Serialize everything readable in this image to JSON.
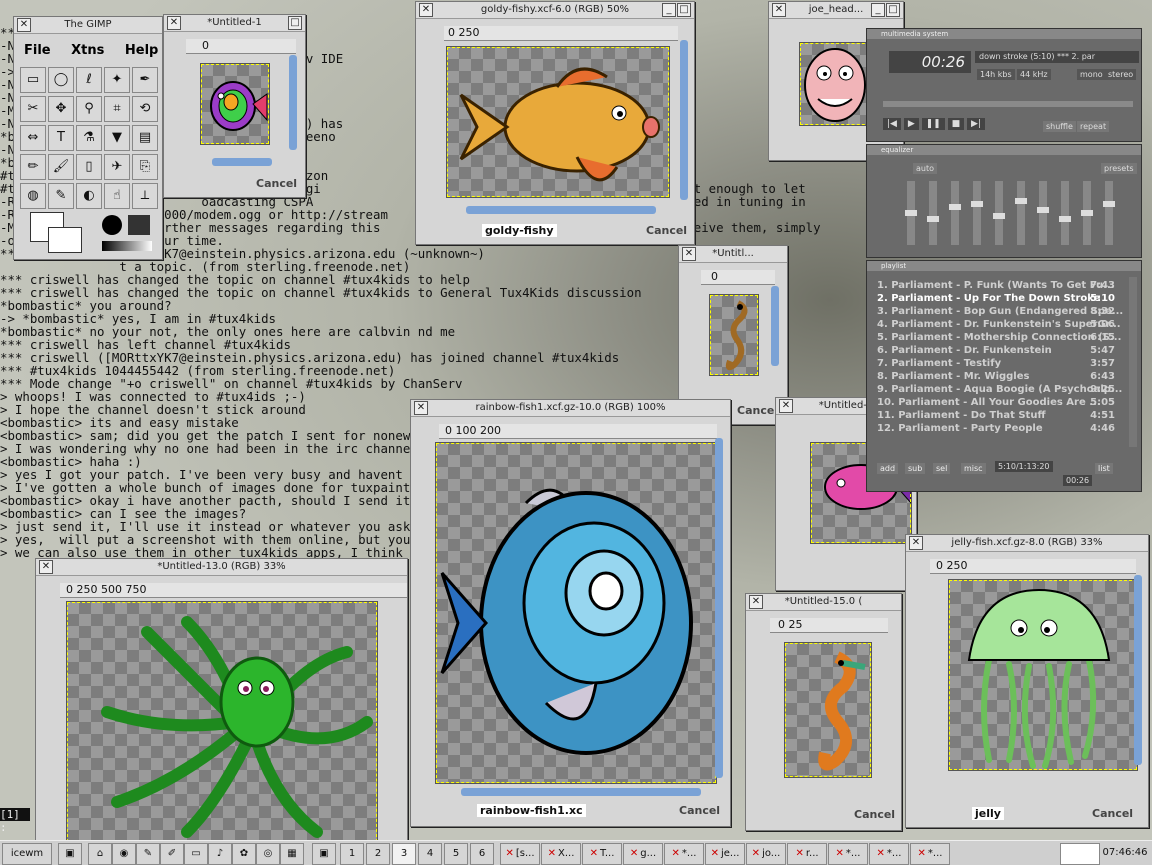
{
  "terminal": {
    "lines": [
      "*** - the network!",
      "-N                            e else",
      "-N                            msg NickServ IDE",
      "->",
      "-N                            recognized",
      "-N                            ervices.",
      "-M",
      "-N                            arizona.edu) has",
      "*b                            sterling.freeno",
      "-N                            node.net)",
      "*b                            criswell",
      "#t                         hn.physics.arizon",
      "#t                         ody.  My apologi                              felt it was important enough to let",
      "-R                         oadcasting CSPA                                 If you're interested in tuning in",
      "-R              org:10000/modem.ogg or http://stream",
      "-M              ce] Further messages regarding this                         you'd like to receive them, simply",
      "-o              for your time.",
      "*** criswell ([MORttxYK7@einstein.physics.arizona.edu (~unknown~)",
      "                t a topic. (from sterling.freenode.net)",
      "*** criswell has changed the topic on channel #tux4kids to help",
      "*** criswell has changed the topic on channel #tux4kids to General Tux4Kids discussion",
      "*bombastic* you around?",
      "-> *bombastic* yes, I am in #tux4kids",
      "*bombastic* no your not, the only ones here are calbvin nd me",
      "*** criswell has left channel #tux4kids",
      "*** criswell ([MORttxYK7@einstein.physics.arizona.edu) has joined channel #tux4kids",
      "*** #tux4kids 1044455442 (from sterling.freenode.net)",
      "*** Mode change \"+o criswell\" on channel #tux4kids by ChanServ",
      "> whoops! I was connected to #tux4ids ;-)",
      "> I hope the channel doesn't stick around",
      "<bombastic> its and easy mistake",
      "<bombastic> sam; did you get the patch I sent for nonews-p",
      "> I was wondering why no one had been in the irc channel f",
      "<bombastic> haha :)",
      "> yes I got your patch. I've been very busy and havent had",
      "> I've gotten a whole bunch of images done for tuxpaint's",
      "<bombastic> okay i have another pacth, should I send it (i",
      "<bombastic> can I see the images?",
      "> just send it, I'll use it instead or whatever you ask...",
      "> yes,  will put a screenshot with them online, but you ca",
      "> we can also use them in other tux4kids apps, I think I'l"
    ],
    "prompt": "[1] :"
  },
  "gimp_toolbox": {
    "title": "The GIMP",
    "menus": [
      "File",
      "Xtns",
      "Help"
    ],
    "tools": [
      "rect-select",
      "ellipse-select",
      "lasso",
      "fuzzy-select",
      "bezier",
      "scissors",
      "move",
      "magnify",
      "crop",
      "transform",
      "flip",
      "text",
      "color-picker",
      "bucket-fill",
      "blend",
      "pencil",
      "paintbrush",
      "eraser",
      "airbrush",
      "clone",
      "convolve",
      "ink",
      "dodge",
      "smudge",
      "measure"
    ]
  },
  "windows": {
    "untitled1": {
      "title": "*Untitled-1",
      "ruler": "0",
      "cancel": "Cancel"
    },
    "goldy": {
      "title": "goldy-fishy.xcf-6.0 (RGB) 50%",
      "ruler": "0          250",
      "name": "goldy-fishy",
      "cancel": "Cancel"
    },
    "joe": {
      "title": "joe_head..."
    },
    "untitled_small": {
      "title": "*Untitl...",
      "ruler": "0",
      "cancel": "Cancel"
    },
    "untitled_r": {
      "title": "*Untitled-1"
    },
    "rainbow": {
      "title": "rainbow-fish1.xcf.gz-10.0 (RGB) 100%",
      "ruler": "0          100           200",
      "name": "rainbow-fish1.xc",
      "cancel": "Cancel"
    },
    "octopus": {
      "title": "*Untitled-13.0 (RGB) 33%",
      "ruler": "0      250     500     750",
      "cancel": "Cancel"
    },
    "untitled15": {
      "title": "*Untitled-15.0 (",
      "ruler": "0      25",
      "cancel": "Cancel"
    },
    "jelly": {
      "title": "jelly-fish.xcf.gz-8.0 (RGB) 33%",
      "ruler": "0          250",
      "name": "jelly",
      "cancel": "Cancel"
    }
  },
  "multimedia": {
    "title": "multimedia system",
    "track": "down stroke (5:10)   *** 2. par",
    "time": "00:26",
    "kbps": "14h kbs",
    "khz": "44 kHz",
    "mono": "mono",
    "stereo": "stereo",
    "shuffle": "shuffle",
    "repeat": "repeat"
  },
  "equalizer": {
    "title": "equalizer",
    "auto": "auto",
    "presets": "presets"
  },
  "playlist": {
    "title": "playlist",
    "items": [
      {
        "label": "1. Parliament - P. Funk (Wants To Get Fu...",
        "len": "7:43"
      },
      {
        "label": "2. Parliament - Up For The Down Stroke",
        "len": "5:10"
      },
      {
        "label": "3. Parliament - Bop Gun (Endangered Spe...",
        "len": "8:32"
      },
      {
        "label": "4. Parliament - Dr. Funkenstein's SuperGr...",
        "len": "5:06"
      },
      {
        "label": "5. Parliament - Mothership Connection (S...",
        "len": "6:15"
      },
      {
        "label": "6. Parliament - Dr. Funkenstein",
        "len": "5:47"
      },
      {
        "label": "7. Parliament - Testify",
        "len": "3:57"
      },
      {
        "label": "8. Parliament - Mr. Wiggles",
        "len": "6:43"
      },
      {
        "label": "9. Parliament - Aqua Boogie (A Psychoalp...",
        "len": "9:25"
      },
      {
        "label": "10. Parliament - All Your Goodies Are ...",
        "len": "5:05"
      },
      {
        "label": "11. Parliament - Do That Stuff",
        "len": "4:51"
      },
      {
        "label": "12. Parliament - Party People",
        "len": "4:46"
      }
    ],
    "buttons": [
      "add",
      "sub",
      "sel",
      "misc",
      "list"
    ],
    "summary": "5:10/1:13:20",
    "elapsed": "00:26"
  },
  "taskbar": {
    "start": "icewm",
    "workspaces": [
      "1",
      "2",
      "3",
      "4",
      "5",
      "6"
    ],
    "tasks": [
      "[s...",
      "X...",
      "T...",
      "g...",
      "*...",
      "je...",
      "jo...",
      "r...",
      "*...",
      "*...",
      "*..."
    ],
    "clock": "07:46:46"
  }
}
